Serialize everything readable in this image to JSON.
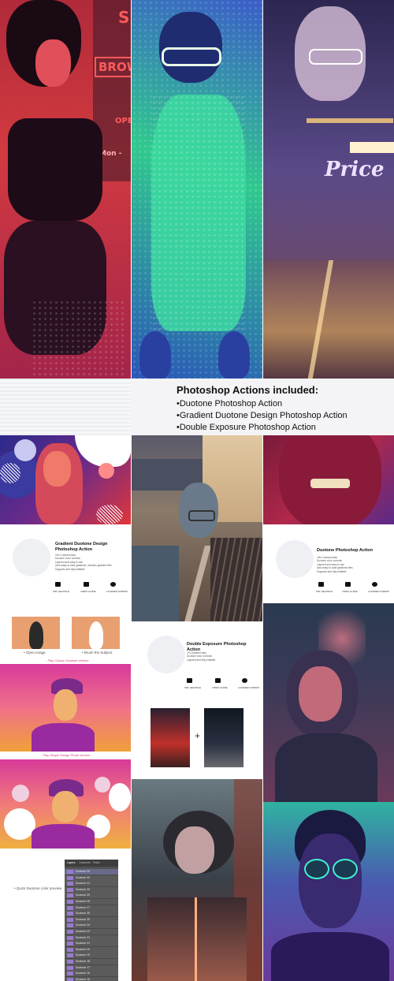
{
  "header": {
    "title": "Photoshop Actions included:",
    "items": [
      "•Duotone Photoshop Action",
      "•Gradient Duotone Design Photoshop Action",
      "•Double Exposure Photoshop Action"
    ]
  },
  "signs": {
    "broadway": "BROWA",
    "open": "OPE",
    "s": "S",
    "mon": "Mon -"
  },
  "neon": {
    "price": "Price"
  },
  "gradient_card": {
    "title": "Gradient Duotone Design Photoshop Action",
    "lines": [
      "1Hz Contrast data",
      "Duotone color controls",
      "Layered and easy to use",
      "Add-ready to load gradients, Includes gradient files",
      "Supports and fully editable"
    ],
    "icons": [
      "PDF HELPFILE",
      "VIDEO GUIDE",
      "LAYERED FORMAT"
    ]
  },
  "duotone_card": {
    "title": "Duotone Photoshop Action",
    "lines": [
      "1Hz Contrast data",
      "Duotone color controls",
      "Layered and easy to use",
      "Add-ready to load gradients files",
      "Supports and fully editable"
    ],
    "icons": [
      "PDF HELPFILE",
      "VIDEO GUIDE",
      "LAYERED FORMAT"
    ]
  },
  "double_card": {
    "title": "Double Exposure Photoshop Action",
    "lines": [
      "1% Gradient data",
      "Duotone color controls",
      "Layered and fully editable"
    ],
    "icons": [
      "PDF HELPFILE",
      "VIDEO GUIDE",
      "LAYERED FORMAT"
    ]
  },
  "steps": {
    "open_image": "• Open Image",
    "brush_subject": "• Brush the Subject",
    "plus": "+"
  },
  "captions": {
    "duotone_preview": "- Play Classic Duotone version",
    "design_preview": "- Play Shape Design Photo version"
  },
  "layers_panel": {
    "note": "• Quick Duotone color preview",
    "tabs": [
      "Layers",
      "Channels",
      "Paths"
    ],
    "rows": [
      "Duotone 33",
      "Duotone 32",
      "Duotone 31",
      "Duotone 30",
      "Duotone 29",
      "Duotone 28",
      "Duotone 27",
      "Duotone 26",
      "Duotone 25",
      "Duotone 24",
      "Duotone 23",
      "Duotone 22",
      "Duotone 21",
      "Duotone 20",
      "Duotone 19",
      "Duotone 18",
      "Duotone 17",
      "Duotone 16",
      "Duotone 15"
    ]
  },
  "colors": {
    "red_duotone": "#c8323c",
    "green_duotone": "#30c98e",
    "purple_duotone": "#5a4a88",
    "pink_gradient": "#d83a9a",
    "orange_gradient": "#f0a03a",
    "teal_duotone": "#2fb3a0"
  }
}
